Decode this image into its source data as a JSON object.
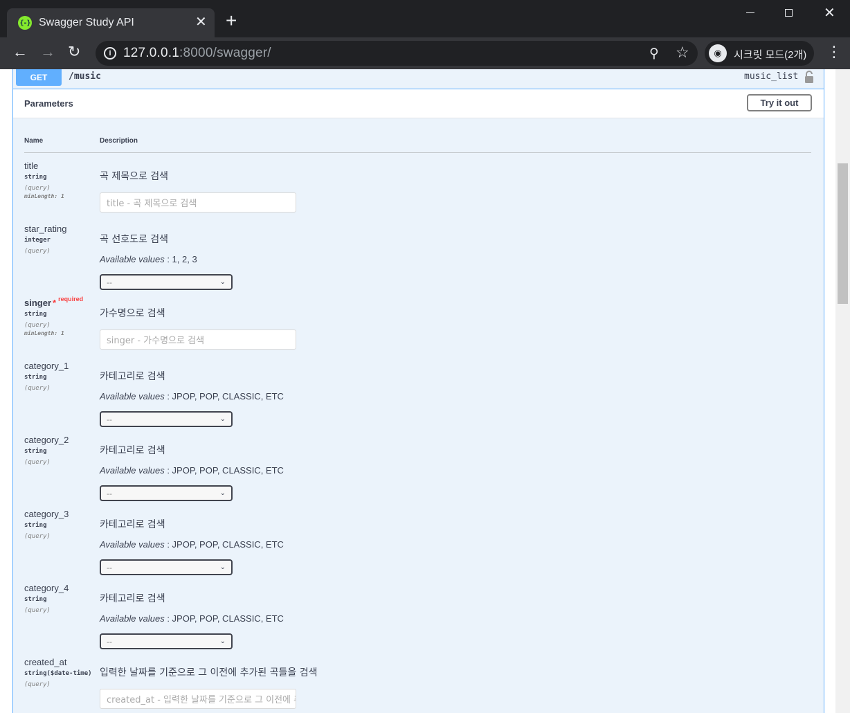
{
  "browser": {
    "tab_title": "Swagger Study API",
    "tab_favicon_text": "{-}",
    "url_host": "127.0.0.1",
    "url_rest": ":8000/swagger/",
    "incognito_label": "시크릿 모드(2개)"
  },
  "operation": {
    "method": "GET",
    "path": "/music",
    "operation_id": "music_list",
    "method_color": "#61affe"
  },
  "parameters_section": {
    "title": "Parameters",
    "try_label": "Try it out",
    "col_name": "Name",
    "col_description": "Description"
  },
  "params": [
    {
      "name": "title",
      "type": "string",
      "in": "(query)",
      "minlength": "minLength: 1",
      "description": "곡 제목으로 검색",
      "placeholder": "title - 곡 제목으로 검색"
    },
    {
      "name": "star_rating",
      "type": "integer",
      "in": "(query)",
      "description": "곡 선호도로 검색",
      "available_label": "Available values",
      "available": " : 1, 2, 3",
      "select_value": "--"
    },
    {
      "name": "singer",
      "required_star": "*",
      "required_text": "required",
      "type": "string",
      "in": "(query)",
      "minlength": "minLength: 1",
      "description": "가수명으로 검색",
      "placeholder": "singer - 가수명으로 검색"
    },
    {
      "name": "category_1",
      "type": "string",
      "in": "(query)",
      "description": "카테고리로 검색",
      "available_label": "Available values",
      "available": " : JPOP, POP, CLASSIC, ETC",
      "select_value": "--"
    },
    {
      "name": "category_2",
      "type": "string",
      "in": "(query)",
      "description": "카테고리로 검색",
      "available_label": "Available values",
      "available": " : JPOP, POP, CLASSIC, ETC",
      "select_value": "--"
    },
    {
      "name": "category_3",
      "type": "string",
      "in": "(query)",
      "description": "카테고리로 검색",
      "available_label": "Available values",
      "available": " : JPOP, POP, CLASSIC, ETC",
      "select_value": "--"
    },
    {
      "name": "category_4",
      "type": "string",
      "in": "(query)",
      "description": "카테고리로 검색",
      "available_label": "Available values",
      "available": " : JPOP, POP, CLASSIC, ETC",
      "select_value": "--"
    },
    {
      "name": "created_at",
      "type": "string($date-time)",
      "in": "(query)",
      "description": "입력한 날짜를 기준으로 그 이전에 추가된 곡들을 검색",
      "placeholder": "created_at - 입력한 날짜를 기준으로 그 이전에 추가된 곡들을 검색"
    }
  ]
}
